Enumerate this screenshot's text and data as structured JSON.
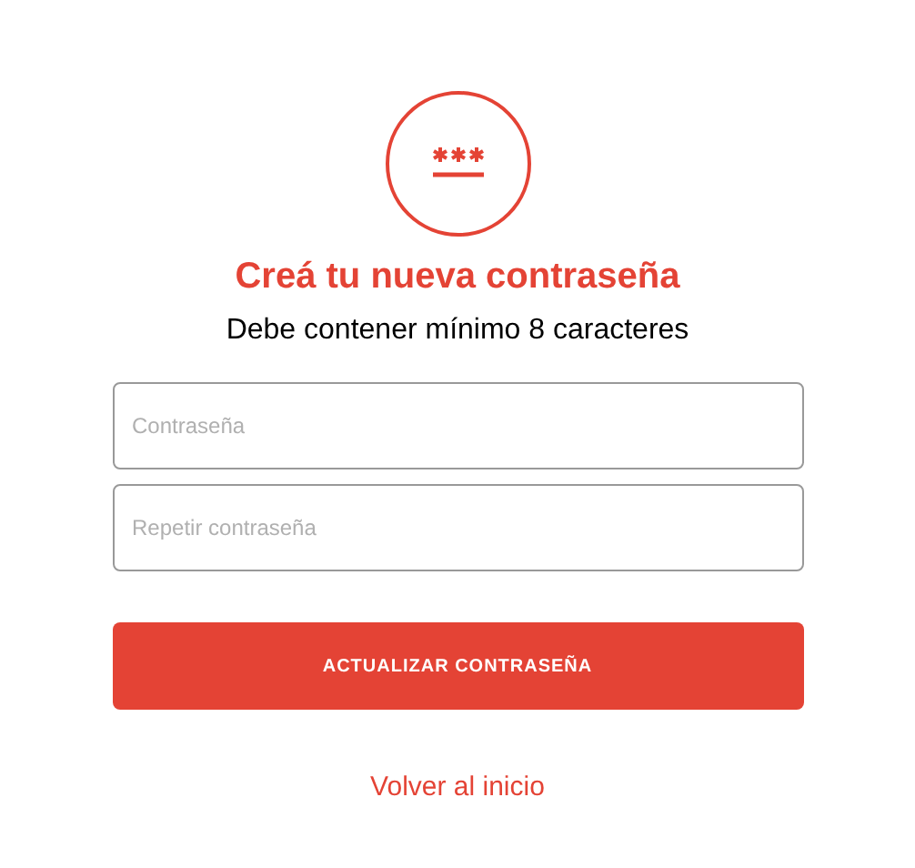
{
  "title": "Creá tu nueva contraseña",
  "subtitle": "Debe contener mínimo 8 caracteres",
  "fields": [
    {
      "placeholder": "Contraseña"
    },
    {
      "placeholder": "Repetir contraseña"
    }
  ],
  "submit_button": "ACTUALIZAR CONTRASEÑA",
  "back_link": "Volver al inicio"
}
